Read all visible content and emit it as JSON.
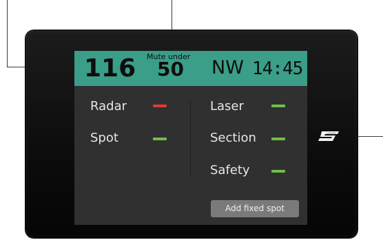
{
  "header": {
    "speed": "116",
    "mute_label": "Mute under",
    "mute_value": "50",
    "heading": "NW",
    "time": "14:45"
  },
  "left_column": [
    {
      "label": "Radar",
      "status_color": "#e03a3a"
    },
    {
      "label": "Spot",
      "status_color": "#6fbf4a"
    }
  ],
  "right_column": [
    {
      "label": "Laser",
      "status_color": "#6fbf4a"
    },
    {
      "label": "Section",
      "status_color": "#6fbf4a"
    },
    {
      "label": "Safety",
      "status_color": "#6fbf4a"
    }
  ],
  "actions": {
    "add_fixed_spot": "Add fixed spot"
  },
  "colors": {
    "header_bg": "#3a9e88",
    "screen_bg": "#303030",
    "ok": "#6fbf4a",
    "alert": "#e03a3a"
  },
  "icons": {
    "device_logo": "brand-logo-icon"
  }
}
